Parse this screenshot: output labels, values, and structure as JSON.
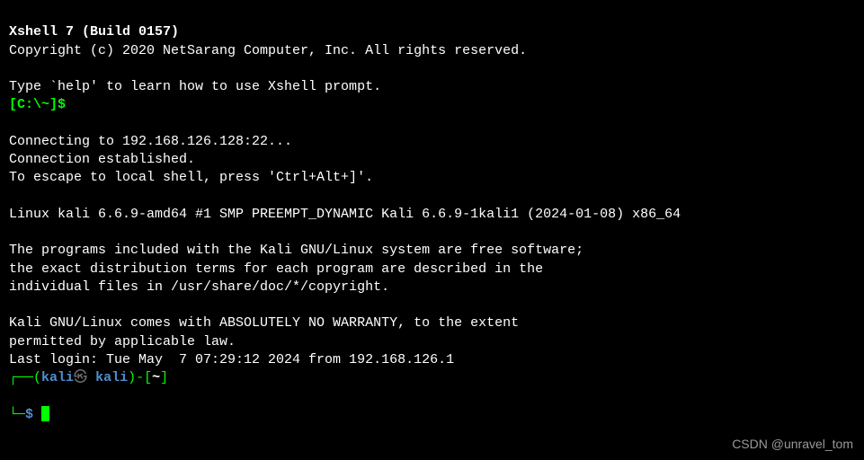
{
  "header": {
    "title": "Xshell 7 (Build 0157)",
    "copyright": "Copyright (c) 2020 NetSarang Computer, Inc. All rights reserved."
  },
  "help_hint": "Type `help' to learn how to use Xshell prompt.",
  "local_prompt": {
    "prefix": "[C:\\~]$",
    "input": ""
  },
  "connection": {
    "connecting": "Connecting to 192.168.126.128:22...",
    "established": "Connection established.",
    "escape_hint": "To escape to local shell, press 'Ctrl+Alt+]'."
  },
  "system_banner": "Linux kali 6.6.9-amd64 #1 SMP PREEMPT_DYNAMIC Kali 6.6.9-1kali1 (2024-01-08) x86_64",
  "motd": {
    "line1": "The programs included with the Kali GNU/Linux system are free software;",
    "line2": "the exact distribution terms for each program are described in the",
    "line3": "individual files in /usr/share/doc/*/copyright.",
    "line4": "Kali GNU/Linux comes with ABSOLUTELY NO WARRANTY, to the extent",
    "line5": "permitted by applicable law."
  },
  "last_login": "Last login: Tue May  7 07:29:12 2024 from 192.168.126.1",
  "kali_prompt": {
    "box_top_left": "┌──",
    "paren_open": "(",
    "user": "kali",
    "at": "㉿",
    "host": "kali",
    "paren_close": ")",
    "dash_bracket": "-[",
    "cwd": "~",
    "bracket_close": "]",
    "box_bottom": "└─",
    "dollar": "$"
  },
  "watermark": "CSDN @unravel_tom"
}
